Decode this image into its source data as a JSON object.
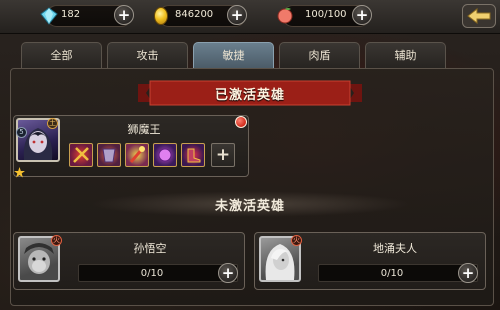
{
  "topbar": {
    "gems": "182",
    "gold": "846200",
    "stamina": "100/100"
  },
  "tabs": [
    {
      "label": "全部",
      "active": false
    },
    {
      "label": "攻击",
      "active": false
    },
    {
      "label": "敏捷",
      "active": true
    },
    {
      "label": "肉盾",
      "active": false
    },
    {
      "label": "辅助",
      "active": false
    }
  ],
  "activated": {
    "title": "已激活英雄",
    "hero": {
      "name": "狮魔王",
      "element_badge": "土",
      "stars": 1,
      "badge_count_left": "5"
    }
  },
  "inactive": {
    "title": "未激活英雄",
    "heroes": [
      {
        "name": "孙悟空",
        "element_badge": "火",
        "progress": "0/10",
        "fraction": 0
      },
      {
        "name": "地涌夫人",
        "element_badge": "火",
        "progress": "0/10",
        "fraction": 0
      }
    ]
  },
  "colors": {
    "ribbon": "#9b1f17",
    "active_tab": "#5a6f7e",
    "notification": "#e03a2a"
  }
}
